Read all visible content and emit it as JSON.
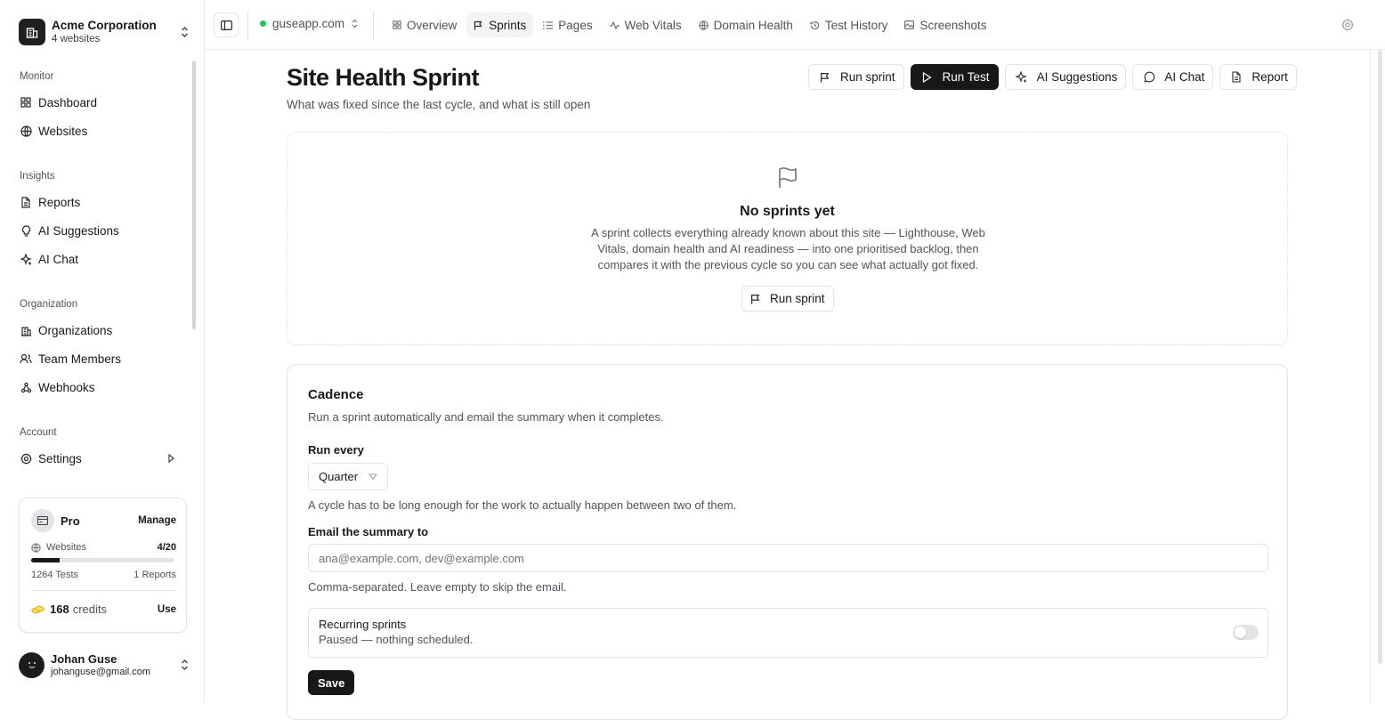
{
  "org": {
    "name": "Acme Corporation",
    "subtitle": "4 websites"
  },
  "sidebar": {
    "sections": [
      {
        "label": "Monitor"
      },
      {
        "label": "Insights"
      },
      {
        "label": "Organization"
      },
      {
        "label": "Account"
      }
    ],
    "items": [
      {
        "label": "Dashboard",
        "icon": "grid-icon"
      },
      {
        "label": "Websites",
        "icon": "globe-icon"
      },
      {
        "label": "Reports",
        "icon": "file-icon"
      },
      {
        "label": "AI Suggestions",
        "icon": "lightbulb-icon"
      },
      {
        "label": "AI Chat",
        "icon": "sparkles-icon"
      },
      {
        "label": "Organizations",
        "icon": "building-icon"
      },
      {
        "label": "Team Members",
        "icon": "users-icon"
      },
      {
        "label": "Webhooks",
        "icon": "webhook-icon"
      },
      {
        "label": "Settings",
        "icon": "gear-icon"
      }
    ]
  },
  "plan": {
    "name": "Pro",
    "manage_label": "Manage",
    "websites_label": "Websites",
    "websites_value": "4/20",
    "websites_fraction": 0.2,
    "tests": "1264 Tests",
    "reports": "1 Reports",
    "credits_value": "168",
    "credits_label": "credits",
    "use_label": "Use"
  },
  "user": {
    "name": "Johan Guse",
    "email": "johanguse@gmail.com"
  },
  "topbar": {
    "site": "guseapp.com",
    "site_status_color": "#22c55e",
    "tabs": [
      {
        "label": "Overview",
        "icon": "grid-icon",
        "active": false
      },
      {
        "label": "Sprints",
        "icon": "flag-icon",
        "active": true
      },
      {
        "label": "Pages",
        "icon": "list-icon",
        "active": false
      },
      {
        "label": "Web Vitals",
        "icon": "pulse-icon",
        "active": false
      },
      {
        "label": "Domain Health",
        "icon": "globe-icon",
        "active": false
      },
      {
        "label": "Test History",
        "icon": "history-icon",
        "active": false
      },
      {
        "label": "Screenshots",
        "icon": "image-icon",
        "active": false
      }
    ]
  },
  "page": {
    "title": "Site Health Sprint",
    "subtitle": "What was fixed since the last cycle, and what is still open",
    "actions": {
      "run_sprint": "Run sprint",
      "run_test": "Run Test",
      "ai_suggestions": "AI Suggestions",
      "ai_chat": "AI Chat",
      "report": "Report"
    }
  },
  "empty": {
    "title": "No sprints yet",
    "description": "A sprint collects everything already known about this site — Lighthouse, Web Vitals, domain health and AI readiness — into one prioritised backlog, then compares it with the previous cycle so you can see what actually got fixed.",
    "button": "Run sprint"
  },
  "cadence": {
    "title": "Cadence",
    "description": "Run a sprint automatically and email the summary when it completes.",
    "run_every_label": "Run every",
    "run_every_value": "Quarter",
    "run_every_hint": "A cycle has to be long enough for the work to actually happen between two of them.",
    "email_label": "Email the summary to",
    "email_placeholder": "ana@example.com, dev@example.com",
    "email_value": "",
    "email_hint": "Comma-separated. Leave empty to skip the email.",
    "recurring_title": "Recurring sprints",
    "recurring_status": "Paused — nothing scheduled.",
    "recurring_enabled": false,
    "save_label": "Save"
  },
  "colors": {
    "primary": "#18181b",
    "muted_text": "#52525b",
    "border": "#e4e4e7",
    "status_ok": "#22c55e"
  }
}
